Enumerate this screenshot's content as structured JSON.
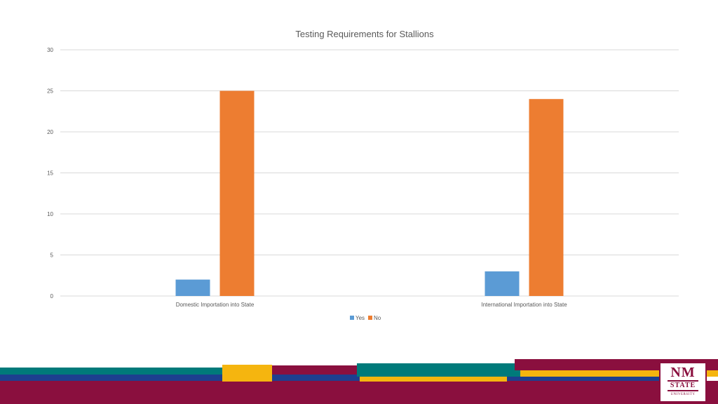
{
  "chart_data": {
    "type": "bar",
    "title": "Testing Requirements for Stallions",
    "categories": [
      "Domestic Importation into State",
      "International Importation into State"
    ],
    "series": [
      {
        "name": "Yes",
        "values": [
          2,
          3
        ],
        "color": "#5b9bd5"
      },
      {
        "name": "No",
        "values": [
          25,
          24
        ],
        "color": "#ed7d31"
      }
    ],
    "ylim": [
      0,
      30
    ],
    "yticks": [
      0,
      5,
      10,
      15,
      20,
      25,
      30
    ],
    "grid": true,
    "legend": "bottom-center"
  },
  "branding": {
    "logo_line1": "NM",
    "logo_line2": "STATE",
    "logo_line3": "UNIVERSITY",
    "colors": {
      "crimson": "#8a0f3e",
      "teal": "#007a7a",
      "gold": "#f5b50f",
      "blue": "#1d3f8f"
    }
  }
}
